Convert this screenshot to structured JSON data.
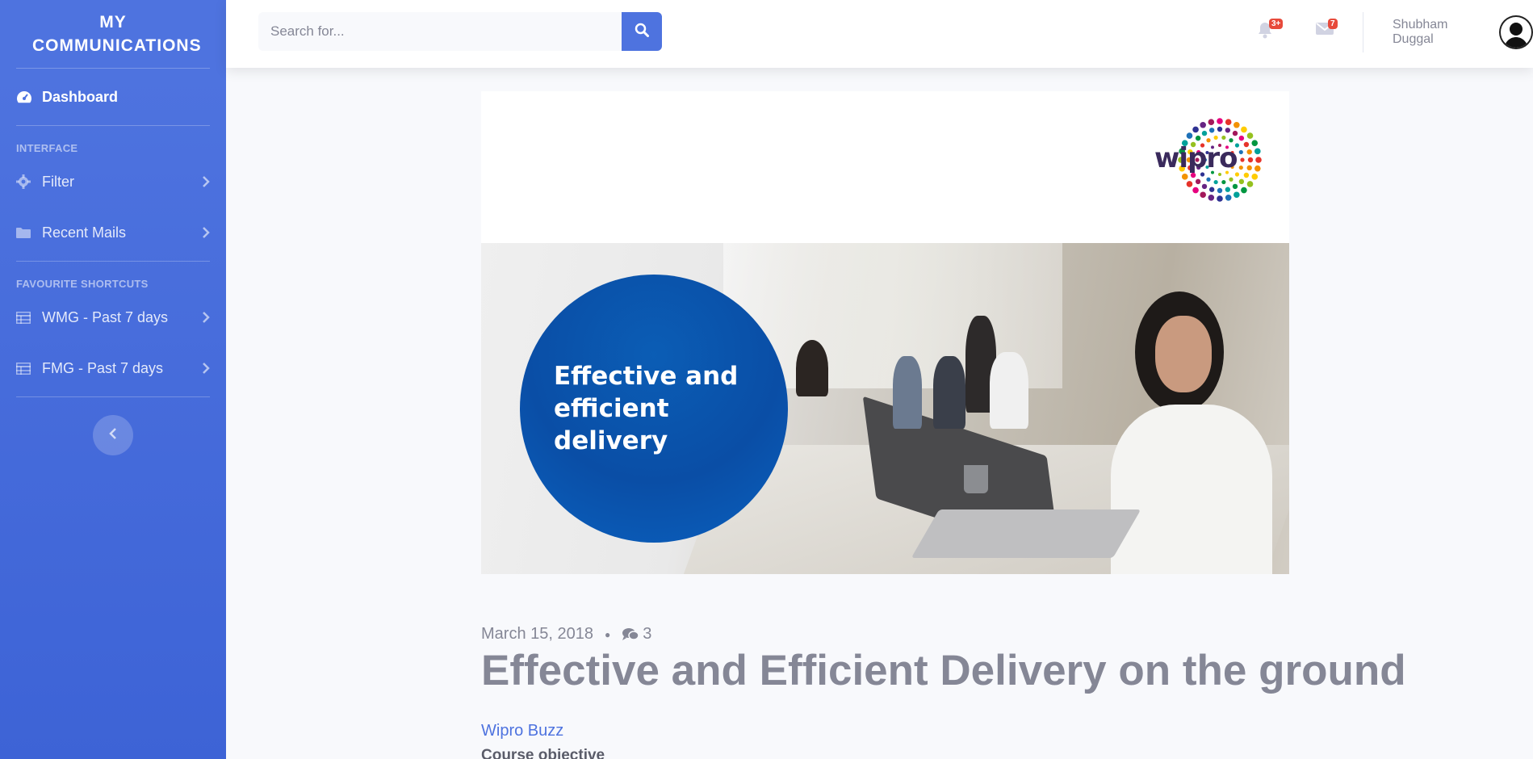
{
  "sidebar": {
    "brand": "MY COMMUNICATIONS",
    "dashboard_label": "Dashboard",
    "section_interface": "INTERFACE",
    "filter_label": "Filter",
    "recent_mails_label": "Recent Mails",
    "section_shortcuts": "FAVOURITE SHORTCUTS",
    "shortcut_wmg": "WMG - Past 7 days",
    "shortcut_fmg": "FMG - Past 7 days"
  },
  "topbar": {
    "search_placeholder": "Search for...",
    "alerts_badge": "3+",
    "messages_badge": "7",
    "user_name": "Shubham Duggal"
  },
  "hero": {
    "logo_text": "wipro",
    "circle_line1": "Effective and",
    "circle_line2": "efficient delivery"
  },
  "post": {
    "date": "March 15, 2018",
    "comment_count": "3",
    "title": "Effective and Efficient Delivery on the ground",
    "category": "Wipro Buzz",
    "subheading": "Course objective"
  },
  "colors": {
    "primary": "#4e73df",
    "badge": "#e74a3b",
    "text_muted": "#858796",
    "background": "#f8f9fc"
  }
}
